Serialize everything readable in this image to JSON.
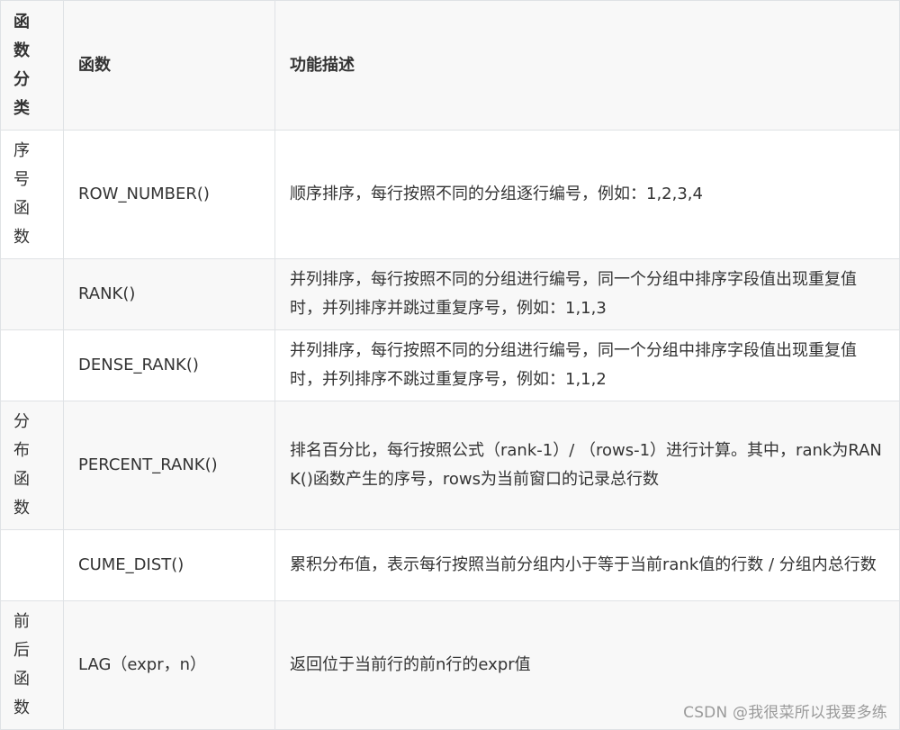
{
  "table": {
    "headers": {
      "category": "函数分类",
      "function": "函数",
      "description": "功能描述"
    },
    "rows": [
      {
        "category": "序号函数",
        "function": "ROW_NUMBER()",
        "description": "顺序排序，每行按照不同的分组逐行编号，例如：1,2,3,4"
      },
      {
        "category": "",
        "function": "RANK()",
        "description": "并列排序，每行按照不同的分组进行编号，同一个分组中排序字段值出现重复值时，并列排序并跳过重复序号，例如：1,1,3"
      },
      {
        "category": "",
        "function": "DENSE_RANK()",
        "description": "并列排序，每行按照不同的分组进行编号，同一个分组中排序字段值出现重复值时，并列排序不跳过重复序号，例如：1,1,2"
      },
      {
        "category": "分布函数",
        "function": "PERCENT_RANK()",
        "description": "排名百分比，每行按照公式（rank-1）/ （rows-1）进行计算。其中，rank为RANK()函数产生的序号，rows为当前窗口的记录总行数"
      },
      {
        "category": "",
        "function": "CUME_DIST()",
        "description": "累积分布值，表示每行按照当前分组内小于等于当前rank值的行数 / 分组内总行数"
      },
      {
        "category": "前后函数",
        "function": "LAG（expr，n）",
        "description": "返回位于当前行的前n行的expr值"
      }
    ]
  },
  "watermark": "CSDN @我很菜所以我要多练"
}
